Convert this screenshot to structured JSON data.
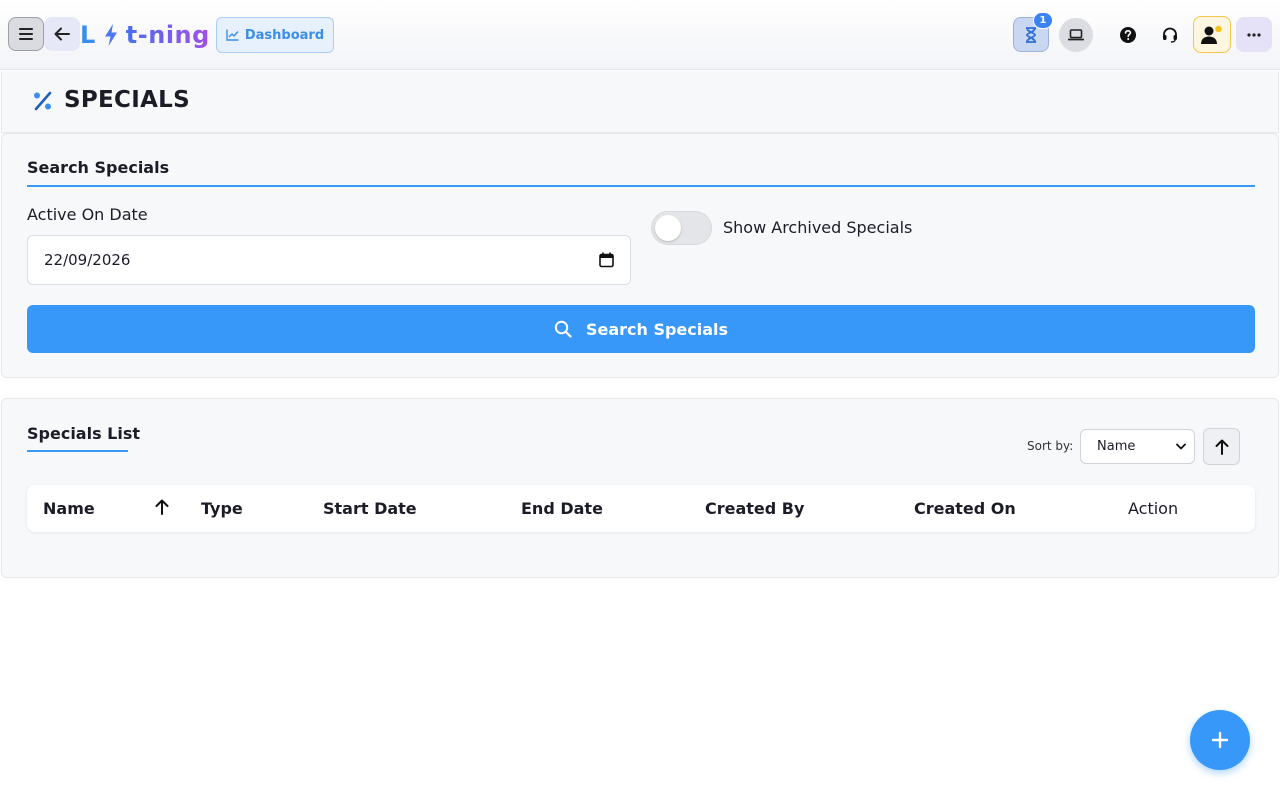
{
  "header": {
    "logo_left": "L",
    "logo_right": "t-ning",
    "dashboard_label": "Dashboard",
    "notification_count": "1"
  },
  "page": {
    "title": "SPECIALS"
  },
  "search": {
    "title": "Search Specials",
    "date_label": "Active On Date",
    "date_value": "22/09/2026",
    "toggle_label": "Show Archived Specials",
    "toggle_on": false,
    "button_label": "Search Specials"
  },
  "list": {
    "title": "Specials List",
    "sort_label": "Sort by:",
    "sort_value": "Name",
    "sort_options": [
      "Name"
    ],
    "columns": [
      "Name",
      "Type",
      "Start Date",
      "End Date",
      "Created By",
      "Created On",
      "Action"
    ],
    "rows": []
  },
  "colors": {
    "accent": "#3898fa",
    "logo_gradient_start": "#4a6ff0",
    "logo_gradient_end": "#a34fe8",
    "badge": "#3b82f6",
    "user_border": "#f3c64a"
  },
  "icons": {
    "menu": "menu-icon",
    "back": "arrow-left-icon",
    "bolt": "lightning-bolt-icon",
    "chart": "chart-line-icon",
    "hourglass": "hourglass-icon",
    "laptop": "laptop-icon",
    "help": "question-circle-icon",
    "support": "headset-icon",
    "user": "user-notification-icon",
    "more": "ellipsis-icon",
    "percent": "percent-icon",
    "calendar": "calendar-icon",
    "search": "search-icon",
    "sort": "arrow-up-icon",
    "add": "plus-icon"
  }
}
